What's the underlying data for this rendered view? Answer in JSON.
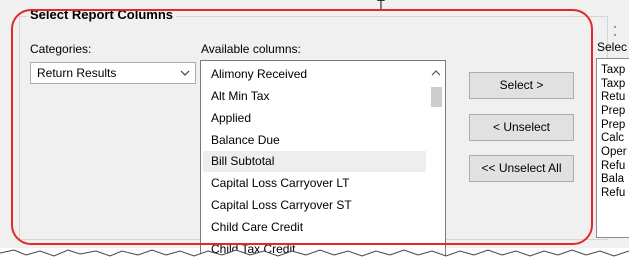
{
  "group": {
    "title": "Select Report Columns"
  },
  "top_glyph": "T",
  "categories": {
    "label": "Categories:",
    "value": "Return Results"
  },
  "available": {
    "label": "Available columns:",
    "items": [
      "Alimony Received",
      "Alt Min Tax",
      "Applied",
      "Balance Due",
      "Bill Subtotal",
      "Capital Loss Carryover LT",
      "Capital Loss Carryover ST",
      "Child Care Credit",
      "Child Tax Credit"
    ],
    "selected_index": 4
  },
  "buttons": {
    "select": "Select >",
    "unselect": "< Unselect",
    "unselect_all": "<< Unselect All"
  },
  "selected_columns": {
    "label": "Selec",
    "items": [
      "Taxp",
      "Taxp",
      "Retu",
      "Prep",
      "Prep",
      "Calc",
      "Oper",
      "Refu",
      "Bala",
      "Refu"
    ]
  },
  "colors": {
    "highlight": "#e02a2a",
    "selected_row": "#eeeeee"
  }
}
